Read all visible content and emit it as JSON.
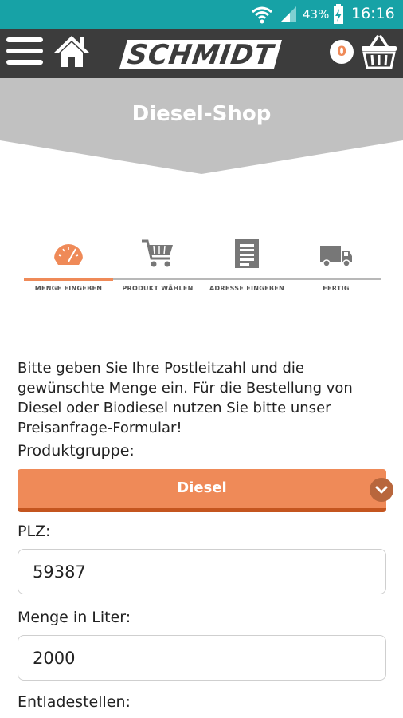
{
  "status_bar": {
    "battery_percent": "43%",
    "time": "16:16",
    "icons": [
      "wifi-icon",
      "signal-icon",
      "battery-charging-icon"
    ]
  },
  "app_bar": {
    "logo_text": "SCHMIDT",
    "cart_count": "0",
    "icons": [
      "menu-icon",
      "home-icon",
      "shopping-basket-icon"
    ]
  },
  "page": {
    "title": "Diesel-Shop"
  },
  "steps": [
    {
      "label": "MENGE EINGEBEN",
      "icon": "gauge-icon",
      "active": true
    },
    {
      "label": "PRODUKT WÄHLEN",
      "icon": "cart-icon",
      "active": false
    },
    {
      "label": "ADRESSE EINGEBEN",
      "icon": "document-icon",
      "active": false
    },
    {
      "label": "FERTIG",
      "icon": "truck-icon",
      "active": false
    }
  ],
  "form": {
    "intro": "Bitte geben Sie Ihre Postleitzahl und die gewünschte Menge ein. Für die Bestellung von Diesel oder Biodiesel nutzen Sie bitte unser Preisanfrage-Formular!",
    "product_group_label": "Produktgruppe:",
    "product_group_value": "Diesel",
    "plz_label": "PLZ:",
    "plz_value": "59387",
    "quantity_label": "Menge in Liter:",
    "quantity_value": "2000",
    "unloading_label": "Entladestellen:"
  },
  "colors": {
    "status_bar": "#17a2a6",
    "app_bar": "#3c3c3c",
    "accent": "#ef8a58",
    "title_band": "#c1c1c1"
  }
}
